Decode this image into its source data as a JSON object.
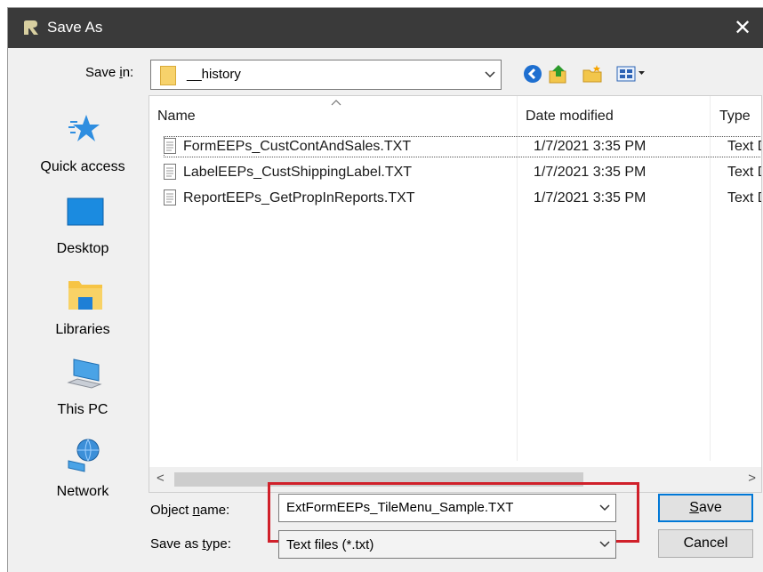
{
  "window": {
    "title": "Save As",
    "close_glyph": "✕"
  },
  "save_in": {
    "label": "Save in:",
    "value": "__history"
  },
  "toolbar": {
    "icons": [
      "back-icon",
      "up-folder-icon",
      "new-folder-icon",
      "view-menu-icon"
    ]
  },
  "places": [
    {
      "label": "Quick access",
      "icon": "quick-access-icon"
    },
    {
      "label": "Desktop",
      "icon": "desktop-icon"
    },
    {
      "label": "Libraries",
      "icon": "libraries-icon"
    },
    {
      "label": "This PC",
      "icon": "this-pc-icon"
    },
    {
      "label": "Network",
      "icon": "network-icon"
    }
  ],
  "columns": {
    "name": "Name",
    "date": "Date modified",
    "type": "Type"
  },
  "files": [
    {
      "name": "FormEEPs_CustContAndSales.TXT",
      "date": "1/7/2021 3:35 PM",
      "type": "Text D"
    },
    {
      "name": "LabelEEPs_CustShippingLabel.TXT",
      "date": "1/7/2021 3:35 PM",
      "type": "Text D"
    },
    {
      "name": "ReportEEPs_GetPropInReports.TXT",
      "date": "1/7/2021 3:35 PM",
      "type": "Text D"
    }
  ],
  "scroll": {
    "left": "<",
    "right": ">"
  },
  "object_name": {
    "label": "Object name:",
    "value": "ExtFormEEPs_TileMenu_Sample.TXT"
  },
  "save_as_type": {
    "label": "Save as type:",
    "value": "Text files (*.txt)"
  },
  "buttons": {
    "save": "Save",
    "cancel": "Cancel"
  },
  "colors": {
    "titlebar": "#3a3a3a",
    "highlight": "#d0202a",
    "accent": "#0078d7"
  }
}
